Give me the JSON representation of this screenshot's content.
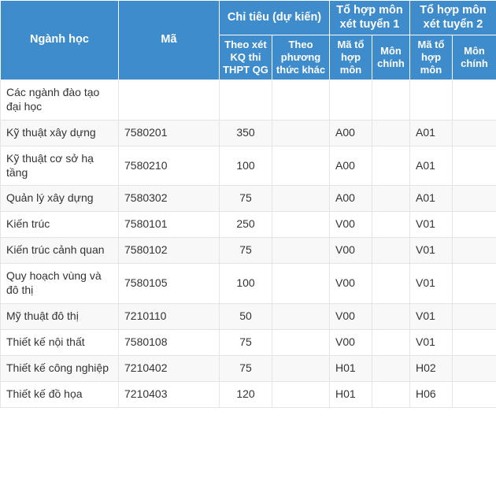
{
  "table": {
    "header": {
      "col_major": "Ngành học",
      "col_code": "Mã",
      "group_quota": "Chỉ tiêu (dự kiến)",
      "group_combo1": "Tổ hợp môn xét tuyển 1",
      "group_combo2": "Tổ hợp môn xét tuyển 2",
      "sub_quota_exam": "Theo xét KQ thi THPT QG",
      "sub_quota_other": "Theo phương thức khác",
      "sub_combo1_code": "Mã tổ hợp môn",
      "sub_combo1_main": "Môn chính",
      "sub_combo2_code": "Mã tổ hợp môn",
      "sub_combo2_main": "Môn chính"
    },
    "rows": [
      {
        "major": "Các ngành đào tạo đại học",
        "code": "",
        "quota_exam": "",
        "quota_other": "",
        "combo1_code": "",
        "combo1_main": "",
        "combo2_code": "",
        "combo2_main": ""
      },
      {
        "major": "Kỹ thuật xây dựng",
        "code": "7580201",
        "quota_exam": "350",
        "quota_other": "",
        "combo1_code": "A00",
        "combo1_main": "",
        "combo2_code": "A01",
        "combo2_main": ""
      },
      {
        "major": "Kỹ thuật cơ sở hạ tầng",
        "code": "7580210",
        "quota_exam": "100",
        "quota_other": "",
        "combo1_code": "A00",
        "combo1_main": "",
        "combo2_code": "A01",
        "combo2_main": ""
      },
      {
        "major": "Quản lý xây dựng",
        "code": "7580302",
        "quota_exam": "75",
        "quota_other": "",
        "combo1_code": "A00",
        "combo1_main": "",
        "combo2_code": "A01",
        "combo2_main": ""
      },
      {
        "major": "Kiến trúc",
        "code": "7580101",
        "quota_exam": "250",
        "quota_other": "",
        "combo1_code": "V00",
        "combo1_main": "",
        "combo2_code": "V01",
        "combo2_main": ""
      },
      {
        "major": "Kiến trúc cảnh quan",
        "code": "7580102",
        "quota_exam": "75",
        "quota_other": "",
        "combo1_code": "V00",
        "combo1_main": "",
        "combo2_code": "V01",
        "combo2_main": ""
      },
      {
        "major": "Quy hoạch vùng và đô thị",
        "code": "7580105",
        "quota_exam": "100",
        "quota_other": "",
        "combo1_code": "V00",
        "combo1_main": "",
        "combo2_code": "V01",
        "combo2_main": ""
      },
      {
        "major": "Mỹ thuật đô thị",
        "code": "7210110",
        "quota_exam": "50",
        "quota_other": "",
        "combo1_code": "V00",
        "combo1_main": "",
        "combo2_code": "V01",
        "combo2_main": ""
      },
      {
        "major": "Thiết kế nội thất",
        "code": "7580108",
        "quota_exam": "75",
        "quota_other": "",
        "combo1_code": "V00",
        "combo1_main": "",
        "combo2_code": "V01",
        "combo2_main": ""
      },
      {
        "major": "Thiết kế công nghiệp",
        "code": "7210402",
        "quota_exam": "75",
        "quota_other": "",
        "combo1_code": "H01",
        "combo1_main": "",
        "combo2_code": "H02",
        "combo2_main": ""
      },
      {
        "major": "Thiết kế đồ họa",
        "code": "7210403",
        "quota_exam": "120",
        "quota_other": "",
        "combo1_code": "H01",
        "combo1_main": "",
        "combo2_code": "H06",
        "combo2_main": ""
      }
    ]
  },
  "colors": {
    "header_bg": "#3e8ccc",
    "header_text": "#ffffff",
    "body_text": "#333333",
    "row_alt_bg": "#f8f8f8",
    "border": "#e4e4e4"
  }
}
